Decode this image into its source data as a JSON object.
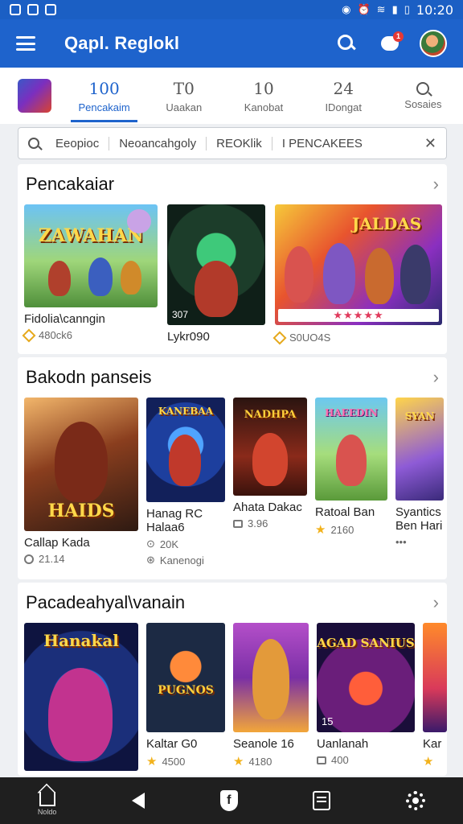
{
  "status_bar": {
    "time": "10:20"
  },
  "app_bar": {
    "title": "Qapl. Reglokl",
    "notification_count": "1"
  },
  "tabs": [
    {
      "num": "100",
      "label": "Pencakaim"
    },
    {
      "num": "T0",
      "label": "Uaakan"
    },
    {
      "num": "10",
      "label": "Kanobat"
    },
    {
      "num": "24",
      "label": "IDongat"
    },
    {
      "num": "",
      "label": "Sosaies"
    }
  ],
  "filters": {
    "chips": [
      "Eeopioc",
      "Neoancahgoly",
      "REOKlik",
      "PENCAKEES"
    ],
    "prefix": "I"
  },
  "sections": [
    {
      "title": "Pencakaiar",
      "items": [
        {
          "name": "Fidolia\\canngin",
          "meta": "480ck6",
          "art_title": "ZAWAHAN",
          "badge": ""
        },
        {
          "name": "Lykr090",
          "meta": "",
          "art_title": "",
          "badge": "307"
        },
        {
          "name": "",
          "meta": "S0UO4S",
          "art_title": "JALDAS",
          "badge": ""
        }
      ]
    },
    {
      "title": "Bakodn panseis",
      "items": [
        {
          "name": "Callap Kada",
          "meta": "21.14",
          "art_title": "HAIDS"
        },
        {
          "name": "Hanag RC",
          "meta": "20K",
          "meta2": "Kanenogi",
          "sub_name": "Halaa6",
          "art_title": "KANEBAA"
        },
        {
          "name": "Ahata Dakac",
          "meta": "3.96",
          "art_title": "NADHPA"
        },
        {
          "name": "Ratoal Ban",
          "meta": "2160",
          "art_title": "HAEEDIN"
        },
        {
          "name": "Syantics",
          "sub_name": "Ben Hari",
          "meta": "",
          "art_title": "SYAN"
        }
      ]
    },
    {
      "title": "Pacadeahyal\\vanain",
      "items": [
        {
          "name": "",
          "meta": "",
          "art_title": "Hanakal"
        },
        {
          "name": "Kaltar G0",
          "meta": "4500",
          "art_title": "PUGNOS"
        },
        {
          "name": "Seanole 16",
          "meta": "4180",
          "art_title": ""
        },
        {
          "name": "Uanlanah",
          "meta": "400",
          "art_title": "AGAD SANIUS",
          "badge": "15"
        },
        {
          "name": "Kar",
          "meta": "",
          "art_title": ""
        }
      ]
    }
  ],
  "nav": {
    "home_label": "Noldo",
    "shield_glyph": "f"
  },
  "colors": {
    "primary": "#1e63cc",
    "status": "#1b5fc4",
    "nav": "#1f1f1f",
    "star": "#f2b21c"
  }
}
